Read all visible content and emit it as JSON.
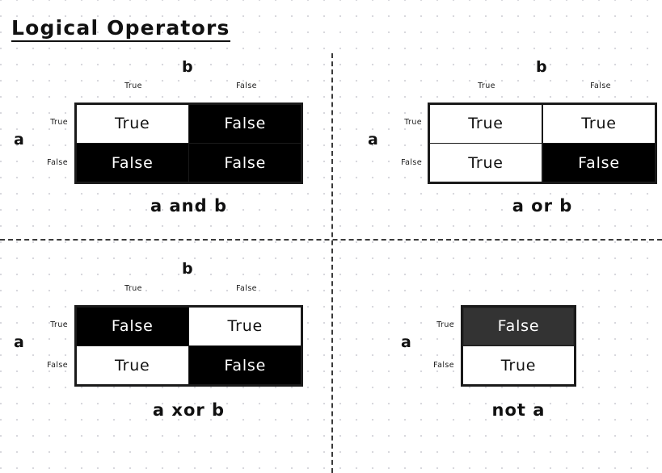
{
  "page": {
    "title": "Logical Operators",
    "background": "#ffffff",
    "dot_color": "#d8d8dd",
    "ink_color": "#111111"
  },
  "panels": [
    {
      "id": "and",
      "caption": "a and b",
      "col_axis_label": "b",
      "row_axis_label": "a",
      "col_headers": [
        "True",
        "False"
      ],
      "row_headers": [
        "True",
        "False"
      ],
      "cells": [
        [
          {
            "text": "True",
            "style": "light"
          },
          {
            "text": "False",
            "style": "dark"
          }
        ],
        [
          {
            "text": "False",
            "style": "dark"
          },
          {
            "text": "False",
            "style": "dark"
          }
        ]
      ]
    },
    {
      "id": "or",
      "caption": "a or b",
      "col_axis_label": "b",
      "row_axis_label": "a",
      "col_headers": [
        "True",
        "False"
      ],
      "row_headers": [
        "True",
        "False"
      ],
      "cells": [
        [
          {
            "text": "True",
            "style": "light"
          },
          {
            "text": "True",
            "style": "light"
          }
        ],
        [
          {
            "text": "True",
            "style": "light"
          },
          {
            "text": "False",
            "style": "dark"
          }
        ]
      ]
    },
    {
      "id": "xor",
      "caption": "a xor b",
      "col_axis_label": "b",
      "row_axis_label": "a",
      "col_headers": [
        "True",
        "False"
      ],
      "row_headers": [
        "True",
        "False"
      ],
      "cells": [
        [
          {
            "text": "False",
            "style": "dark"
          },
          {
            "text": "True",
            "style": "light"
          }
        ],
        [
          {
            "text": "True",
            "style": "light"
          },
          {
            "text": "False",
            "style": "dark"
          }
        ]
      ]
    },
    {
      "id": "not",
      "caption": "not a",
      "col_axis_label": "",
      "row_axis_label": "a",
      "col_headers": [],
      "row_headers": [
        "True",
        "False"
      ],
      "cells": [
        [
          {
            "text": "False",
            "style": "gray"
          }
        ],
        [
          {
            "text": "True",
            "style": "light"
          }
        ]
      ]
    }
  ]
}
